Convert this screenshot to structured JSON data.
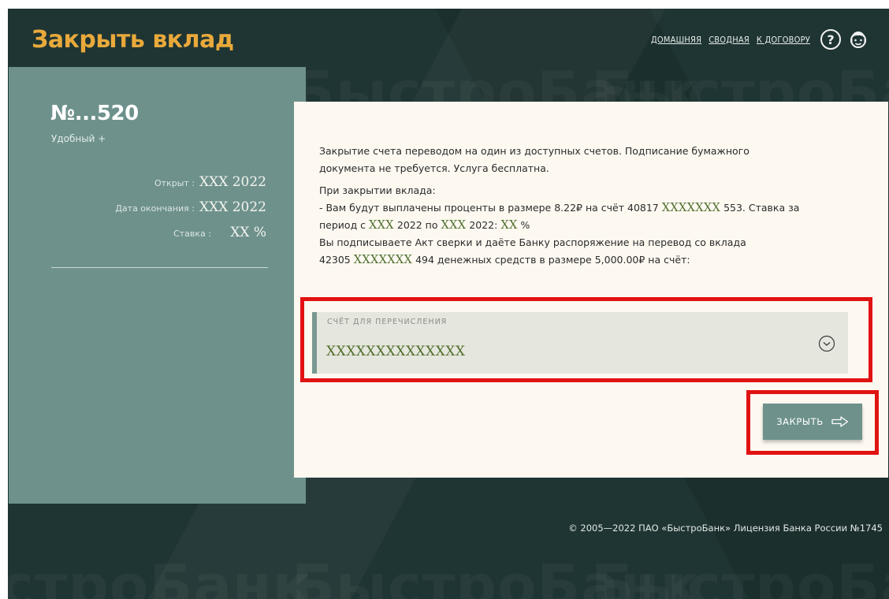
{
  "header": {
    "title": "Закрыть вклад",
    "nav": [
      "ДОМАШНЯЯ",
      "СВОДНАЯ",
      "К ДОГОВОРУ"
    ],
    "help_symbol": "?",
    "icons": {
      "help": "help-circle-icon",
      "profile": "user-avatar-icon"
    }
  },
  "watermark": {
    "w1": "БыстроБанк",
    "w2": "БыстроБанк",
    "w3": "строБанк",
    "w4": "БыстроБанк",
    "w5": "БыстроБанк"
  },
  "account": {
    "number": "№...520",
    "type": "Удобный +",
    "rows": [
      {
        "label": "Открыт :",
        "value": "XXX 2022"
      },
      {
        "label": "Дата окончания :",
        "value": "XXX 2022"
      },
      {
        "label": "Ставка :",
        "value": "XX %"
      }
    ]
  },
  "card": {
    "line1": "Закрытие счета переводом на один из доступных счетов. Подписание бумажного",
    "line2": "документа не требуется. Услуга бесплатна.",
    "line3": "При закрытии вклада:",
    "l4_a": "- Вам будут выплачены проценты в размере 8.22₽ на счёт 40817 ",
    "l4_mask": "XXXXXXX",
    "l4_b": " 553. Ставка за",
    "l5_a": "период с ",
    "l5_mask1": "XXX",
    "l5_b": " 2022 по ",
    "l5_mask2": "XXX",
    "l5_c": " 2022:  ",
    "l5_mask3": "XX",
    "l5_d": " %",
    "line6": "Вы подписываете Акт сверки и даёте Банку распоряжение на перевод со вклада",
    "l7_a": "42305 ",
    "l7_mask": "XXXXXXX",
    "l7_b": " 494 денежных средств в размере 5,000.00₽ на счёт:"
  },
  "select": {
    "label": "СЧЁТ ДЛЯ ПЕРЕЧИСЛЕНИЯ",
    "value": "XXXXXXXXXXXXXX",
    "icon": "chevron-down-circle-icon"
  },
  "button": {
    "label": "ЗАКРЫТЬ",
    "icon": "arrow-right-icon"
  },
  "colors": {
    "accent_title": "#e9a93b",
    "panel": "#6e918c",
    "highlight": "#e11212",
    "mask_text": "#4f6f2c"
  },
  "footer": {
    "text": "© 2005—2022 ПАО «БыстроБанк» Лицензия Банка России №1745"
  }
}
